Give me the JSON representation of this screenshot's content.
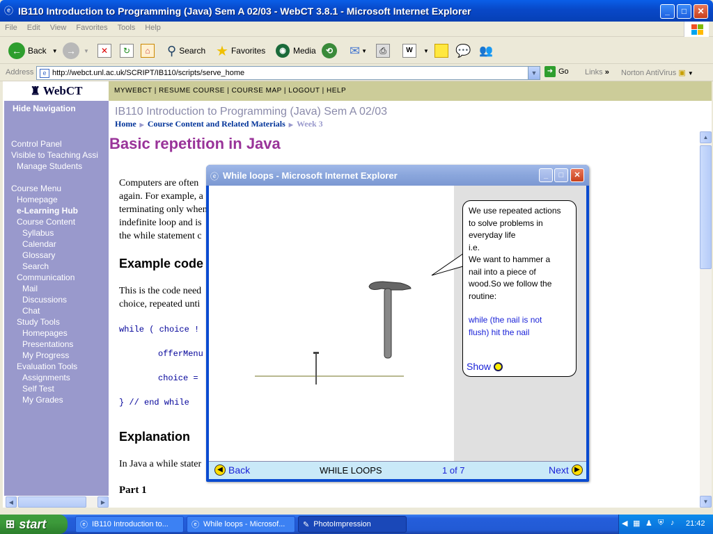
{
  "window": {
    "title": "IB110 Introduction to Programming (Java) Sem A 02/03 - WebCT 3.8.1 - Microsoft Internet Explorer",
    "icon": "ie-icon"
  },
  "menu": [
    "File",
    "Edit",
    "View",
    "Favorites",
    "Tools",
    "Help"
  ],
  "toolbar": {
    "back": "Back",
    "search": "Search",
    "favorites": "Favorites",
    "media": "Media"
  },
  "address": {
    "label": "Address",
    "url": "http://webct.unl.ac.uk/SCRIPT/IB110/scripts/serve_home",
    "go": "Go",
    "links": "Links",
    "norton": "Norton AntiVirus"
  },
  "webct": {
    "logo": "WebCT",
    "hide_nav": "Hide Navigation",
    "topnav": "MYWEBCT  |  RESUME COURSE  |  COURSE MAP  |  LOGOUT  |  HELP",
    "nav_items": [
      {
        "label": "Control Panel"
      },
      {
        "label": "Visible to Teaching Assi"
      },
      {
        "label": "Manage Students"
      },
      {
        "label": "Course Menu"
      },
      {
        "label": "Homepage"
      },
      {
        "label": "e-Learning Hub"
      },
      {
        "label": "Course Content"
      },
      {
        "label": "Syllabus"
      },
      {
        "label": "Calendar"
      },
      {
        "label": "Glossary"
      },
      {
        "label": "Search"
      },
      {
        "label": "Communication"
      },
      {
        "label": "Mail"
      },
      {
        "label": "Discussions"
      },
      {
        "label": "Chat"
      },
      {
        "label": "Study Tools"
      },
      {
        "label": "Homepages"
      },
      {
        "label": "Presentations"
      },
      {
        "label": "My Progress"
      },
      {
        "label": "Evaluation Tools"
      },
      {
        "label": "Assignments"
      },
      {
        "label": "Self Test"
      },
      {
        "label": "My Grades"
      }
    ],
    "course_title": "IB110 Introduction to Programming (Java) Sem A 02/03",
    "breadcrumb": {
      "home": "Home",
      "content": "Course Content and Related Materials",
      "current": "Week 3"
    }
  },
  "page": {
    "heading": "Basic repetition in Java",
    "para1": [
      "Computers are often",
      "again. For example, a",
      "terminating only when",
      "indefinite loop and is",
      "the while statement c"
    ],
    "h_example": "Example code",
    "para2": [
      "This is the code need",
      "choice, repeated unti"
    ],
    "code": [
      "while ( choice !",
      "offerMenu",
      "choice =",
      "} // end while"
    ],
    "h_explanation": "Explanation",
    "para3": "In Java a while stater",
    "part1": "Part 1"
  },
  "popup": {
    "title": "While loops - Microsoft Internet Explorer",
    "bubble_lines": [
      "We use repeated actions",
      "to solve problems in",
      "everyday life",
      "i.e.",
      "We want to hammer a",
      "nail into a piece of",
      "wood.So we follow the",
      "routine:"
    ],
    "bubble_blue": [
      "while (the nail is not",
      "flush) hit the nail"
    ],
    "show": "Show",
    "back": "Back",
    "section": "WHILE LOOPS",
    "pager": "1 of 7",
    "next": "Next"
  },
  "taskbar": {
    "start": "start",
    "tasks": [
      {
        "label": "IB110 Introduction to..."
      },
      {
        "label": "While loops - Microsof..."
      },
      {
        "label": "PhotoImpression"
      }
    ],
    "clock": "21:42"
  },
  "colors": {
    "nav_bg": "#9999cc",
    "topnav_bg": "#cccc99",
    "heading": "#993399",
    "link": "#003399",
    "code": "#000099",
    "bubble_blue": "#1a22d8"
  }
}
